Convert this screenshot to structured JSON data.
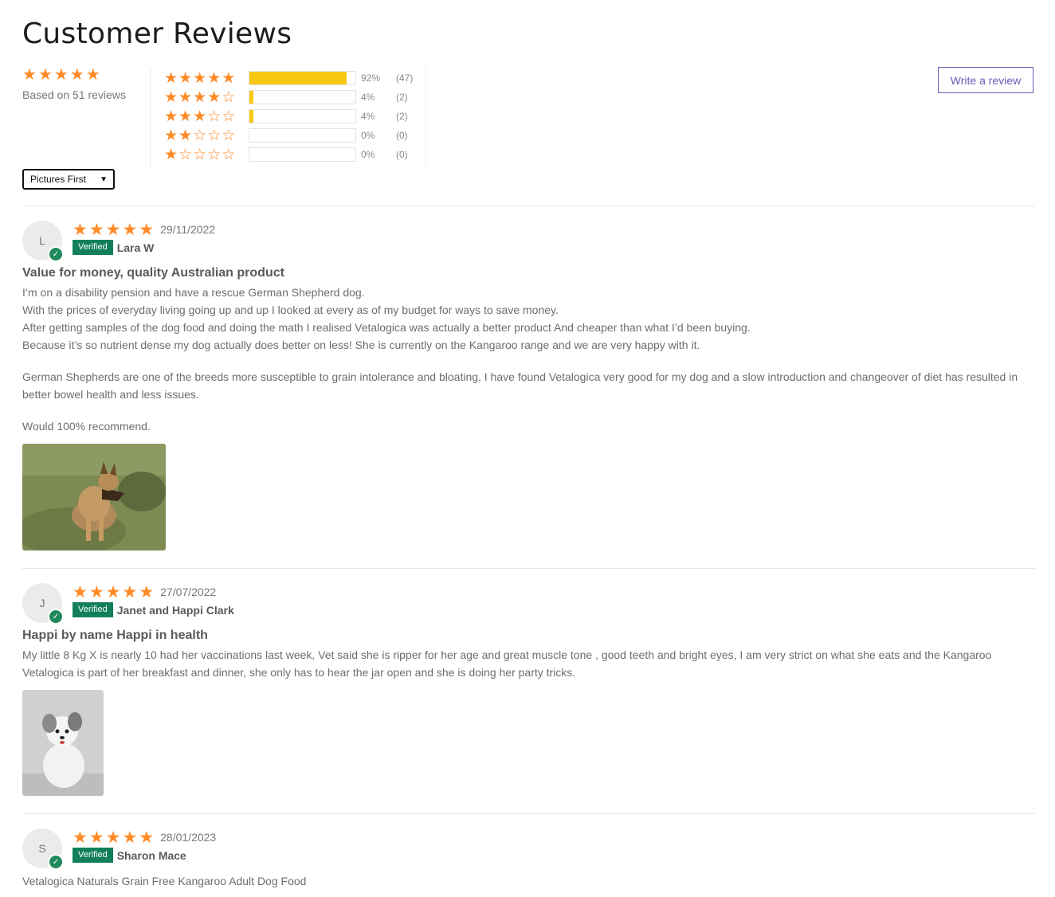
{
  "header": {
    "title": "Customer Reviews"
  },
  "summary": {
    "average_stars": 5,
    "based_on": "Based on 51 reviews"
  },
  "histogram": [
    {
      "stars": 5,
      "percent": 92,
      "percent_label": "92%",
      "count_label": "(47)"
    },
    {
      "stars": 4,
      "percent": 4,
      "percent_label": "4%",
      "count_label": "(2)"
    },
    {
      "stars": 3,
      "percent": 4,
      "percent_label": "4%",
      "count_label": "(2)"
    },
    {
      "stars": 2,
      "percent": 0,
      "percent_label": "0%",
      "count_label": "(0)"
    },
    {
      "stars": 1,
      "percent": 0,
      "percent_label": "0%",
      "count_label": "(0)"
    }
  ],
  "actions": {
    "write_review": "Write a review"
  },
  "sort": {
    "selected": "Pictures First"
  },
  "colors": {
    "star": "#ff8a26",
    "bar_fill": "#f8c815",
    "verified": "#127f5c",
    "button_accent": "#6f57b8"
  },
  "reviews": [
    {
      "initial": "L",
      "stars": 5,
      "date": "29/11/2022",
      "verified_label": "Verified",
      "author": "Lara W",
      "title": "Value for money, quality Australian product",
      "paragraphs": [
        "I’m on a disability pension and have a rescue German Shepherd dog.",
        "With the prices of everyday living going up and up I looked at every as of my budget for ways to save money.",
        "After getting samples of the dog food and doing the math I realised Vetalogica was actually a better product And cheaper than what I’d been buying.",
        "Because it’s so nutrient dense my dog actually does better on less! She is currently on the Kangaroo range and we are very happy with it.",
        "German Shepherds are one of the breeds more susceptible to grain intolerance and bloating, I have found Vetalogica very good for my dog and a slow introduction and changeover of diet has resulted in better bowel health and less issues.",
        "Would 100% recommend."
      ],
      "photo": "german-shepherd-photo"
    },
    {
      "initial": "J",
      "stars": 5,
      "date": "27/07/2022",
      "verified_label": "Verified",
      "author": "Janet and Happi Clark",
      "title": "Happi by name Happi in health",
      "paragraphs": [
        "My little 8 Kg X is nearly 10 had her vaccinations last week, Vet said she is ripper for her age and great muscle tone , good teeth and bright eyes, I am very strict on what she eats and the Kangaroo Vetalogica is part of her breakfast and dinner, she only has to hear the jar open and she is doing her party tricks."
      ],
      "photo": "small-white-dog-photo"
    },
    {
      "initial": "S",
      "stars": 5,
      "date": "28/01/2023",
      "verified_label": "Verified",
      "author": "Sharon Mace",
      "paragraphs": [
        "Vetalogica Naturals Grain Free Kangaroo Adult Dog Food"
      ]
    }
  ]
}
